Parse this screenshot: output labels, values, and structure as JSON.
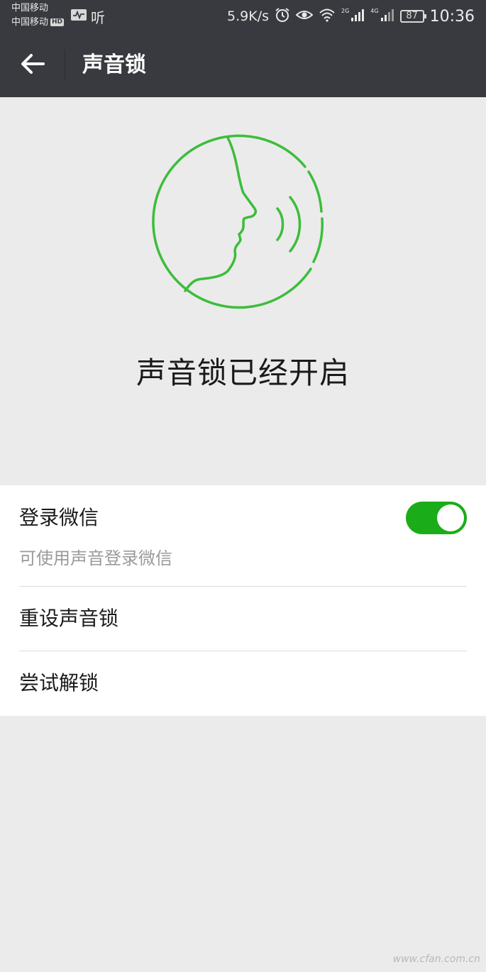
{
  "status_bar": {
    "carrier_1": "中国移动",
    "carrier_2": "中国移动",
    "hd_badge": "HD",
    "listen_label": "听",
    "net_speed": "5.9K/s",
    "signal_tag_1": "2G",
    "signal_tag_2": "4G",
    "battery": "87",
    "time": "10:36"
  },
  "header": {
    "title": "声音锁",
    "back_icon": "arrow-left-icon"
  },
  "hero": {
    "status_text": "声音锁已经开启",
    "icon": "voice-face-icon",
    "accent_color": "#3dbd3b"
  },
  "settings": {
    "login_label": "登录微信",
    "login_desc": "可使用声音登录微信",
    "login_enabled": true,
    "toggle_color": "#1aad19",
    "reset_label": "重设声音锁",
    "try_label": "尝试解锁"
  },
  "watermark": "www.cfan.com.cn"
}
